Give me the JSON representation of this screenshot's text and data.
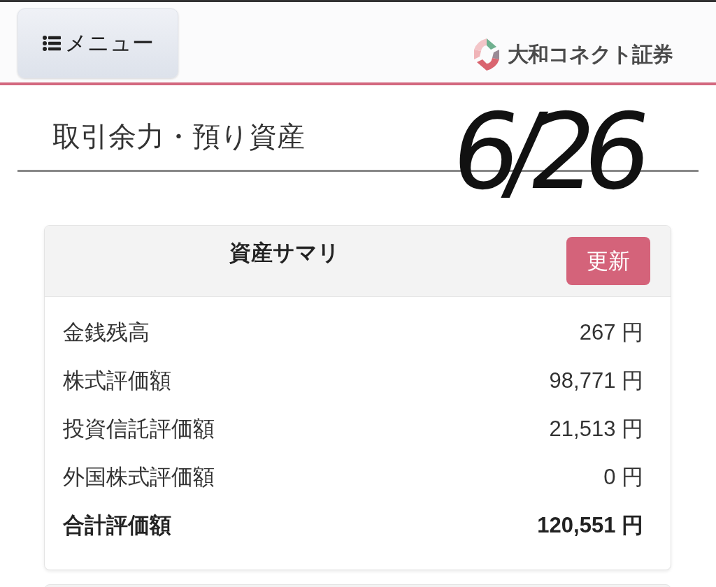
{
  "header": {
    "menu_button": {
      "label": "メニュー"
    },
    "logo": {
      "text": "大和コネクト証券"
    }
  },
  "page_title": "取引余力・預り資産",
  "annotation": {
    "text": "6/26"
  },
  "summary": {
    "title": "資産サマリ",
    "refresh_button": "更新",
    "rows": [
      {
        "label": "金銭残高",
        "value": "267 円",
        "kind": "item"
      },
      {
        "label": "株式評価額",
        "value": "98,771 円",
        "kind": "item"
      },
      {
        "label": "投資信託評価額",
        "value": "21,513 円",
        "kind": "item"
      },
      {
        "label": "外国株式評価額",
        "value": "0 円",
        "kind": "item"
      },
      {
        "label": "合計評価額",
        "value": "120,551 円",
        "kind": "total"
      }
    ]
  }
}
